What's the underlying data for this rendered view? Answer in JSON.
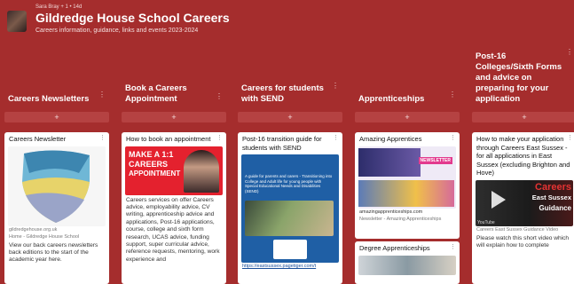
{
  "header": {
    "meta": "Sara Bray + 1 • 14d",
    "title": "Gildredge House School Careers",
    "subtitle": "Careers information, guidance, links and events 2023-2024"
  },
  "columns": [
    {
      "title": "Careers Newsletters",
      "cards": [
        {
          "title": "Careers Newsletter",
          "link": "gildredgehouse.org.uk",
          "source": "Home - Gildredge House School",
          "body": "View our back careers newsletters back editions to the start of the academic year here."
        }
      ]
    },
    {
      "title": "Book a Careers Appointment",
      "cards": [
        {
          "title": "How to book an appointment",
          "poster_line1": "MAKE A 1:1",
          "poster_line2": "CAREERS",
          "poster_line3": "APPOINTMENT",
          "body": "Careers services on offer Careers advice, employability advice, CV writing, apprenticeship advice and applications, Post-16 applications, course, college and sixth form research, UCAS advice, funding support, super curricular advice, reference requests, mentoring, work experience and"
        }
      ]
    },
    {
      "title": "Careers for students with SEND",
      "cards": [
        {
          "title": "Post-16 transition guide for students with SEND",
          "guide_text": "A guide for parents and carers - Transitioning into College and Adult life for young people with Special Educational Needs and Disabilities (SEND)",
          "link": "https://eastsussex.pagetiger.com/t"
        }
      ]
    },
    {
      "title": "Apprenticeships",
      "cards": [
        {
          "title": "Amazing Apprentices",
          "badge": "NEWSLETTER",
          "link": "amazingapprenticeships.com",
          "source": "Newsletter - Amazing Apprenticeships"
        },
        {
          "title": "Degree Apprenticeships"
        }
      ]
    },
    {
      "title": "Post-16 Colleges/Sixth Forms and advice on preparing for your application",
      "cards": [
        {
          "title": "How to make your application through Careers East Sussex - for all applications in East Sussex (excluding Brighton and Hove)",
          "video_brand": "Careers",
          "video_brand2": "East Sussex",
          "video_caption": "Guidance",
          "video_source": "YouTube",
          "source": "Careers East Sussex Guidance Video",
          "body": "Please watch this short video which will explain how to complete"
        }
      ]
    }
  ],
  "ui": {
    "add": "+",
    "menu": "⋮"
  },
  "colors": {
    "background": "#a52d2d",
    "header_band": "#9a2929",
    "add_bar": "#b54242"
  }
}
